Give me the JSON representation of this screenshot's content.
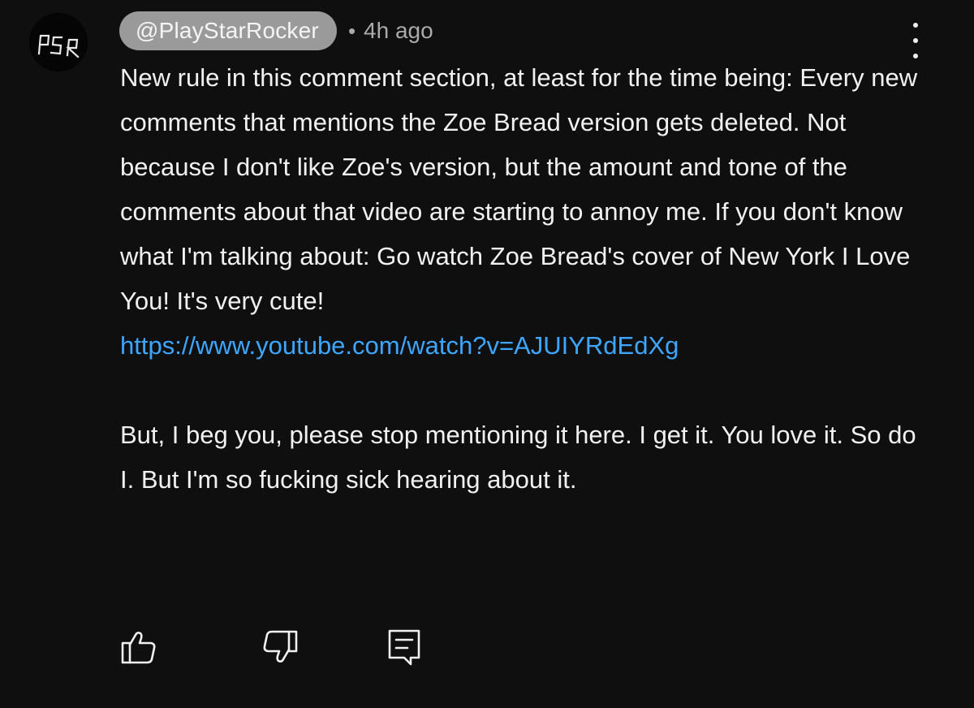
{
  "comment": {
    "avatar_text": "PSR",
    "author": "@PlayStarRocker",
    "separator": "•",
    "time": "4h ago",
    "paragraph_1": "New rule in this  comment section, at least for the time being: Every new comments that mentions the Zoe Bread version gets deleted. Not because I don't like Zoe's version, but the amount and tone of the comments about that video are starting to annoy me. If you don't know what I'm talking about: Go watch Zoe Bread's cover of New York I Love You! It's very cute!",
    "link": "https://www.youtube.com/watch?v=AJUIYRdEdXg",
    "paragraph_2": "But, I beg you, please stop mentioning it here. I get it. You love it. So do I. But I'm so fucking sick hearing about it."
  },
  "actions": {
    "like_icon": "thumbs-up-icon",
    "dislike_icon": "thumbs-down-icon",
    "reply_icon": "reply-comment-icon",
    "more_icon": "vertical-ellipsis-icon"
  },
  "colors": {
    "background": "#0f0f0f",
    "text": "#f1f1f1",
    "link": "#3ea6ff",
    "author_chip": "#9a9a9a",
    "meta": "#aaaaaa"
  }
}
